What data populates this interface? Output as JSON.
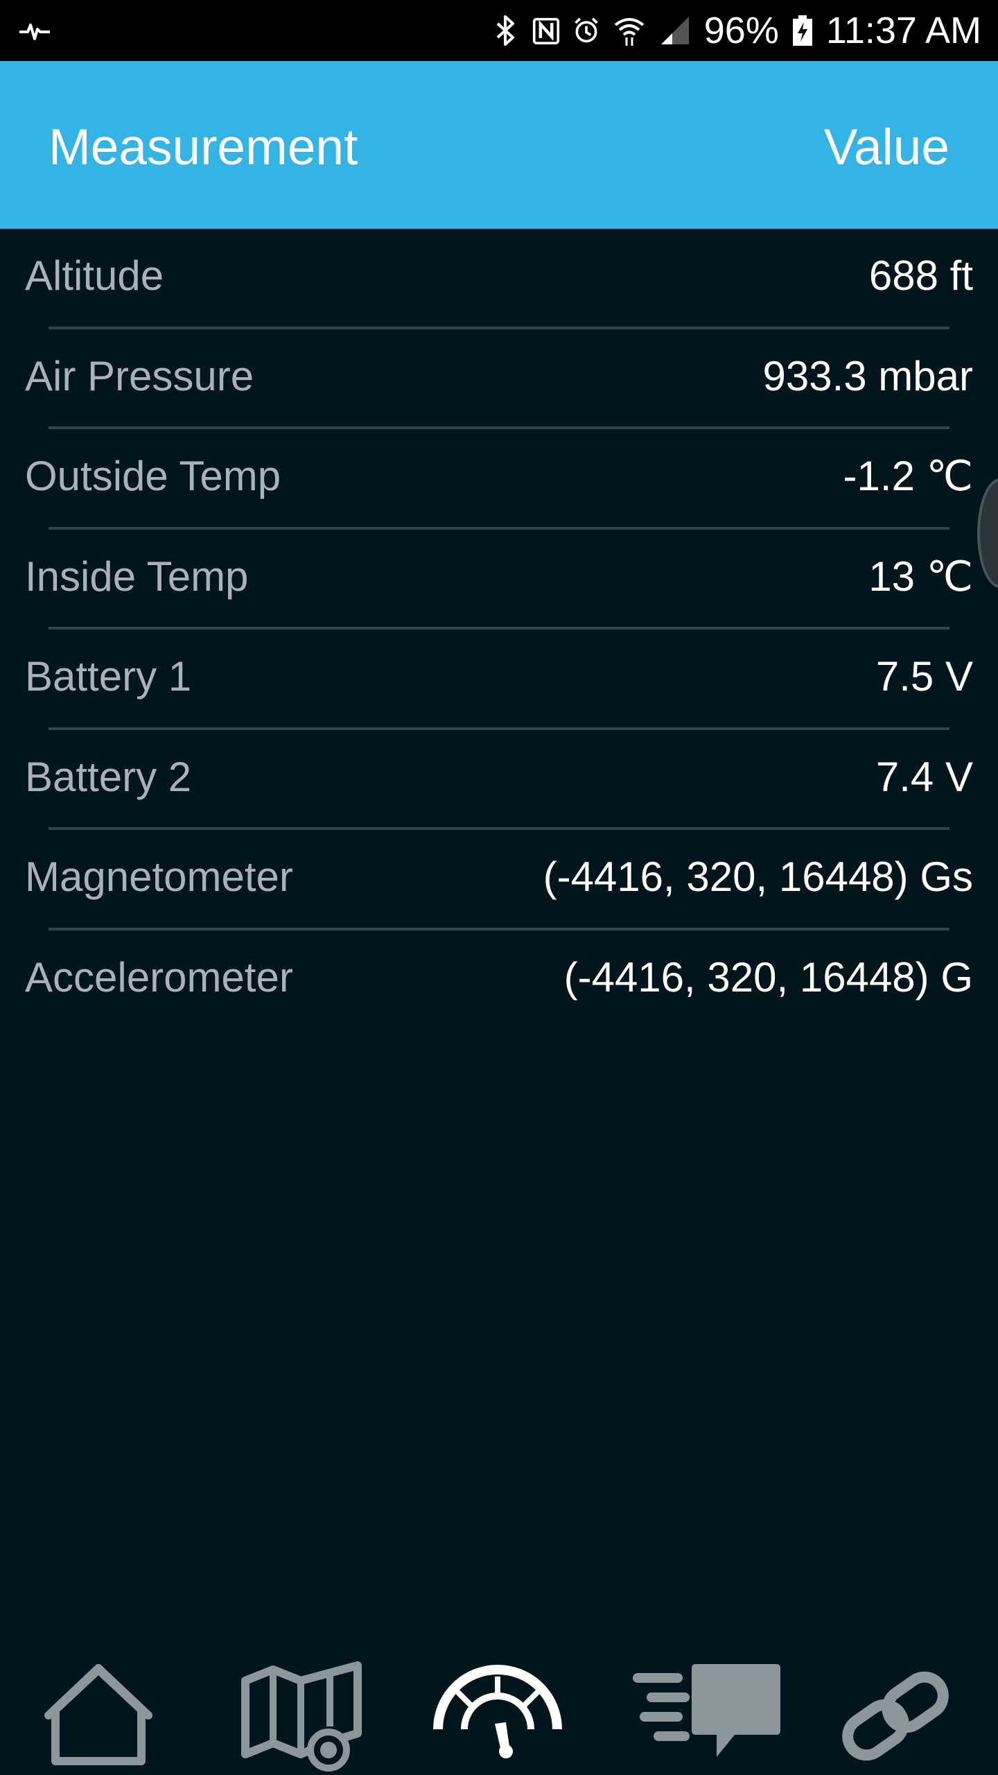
{
  "status_bar": {
    "battery": "96%",
    "time": "11:37 AM",
    "icons": [
      "heartbeat-icon",
      "bluetooth-icon",
      "nfc-icon",
      "alarm-icon",
      "wifi-icon",
      "signal-icon",
      "battery-charging-icon"
    ]
  },
  "header": {
    "col_measurement": "Measurement",
    "col_value": "Value",
    "background_color": "#34b4e4"
  },
  "measurements": [
    {
      "label": "Altitude",
      "value": "688 ft"
    },
    {
      "label": "Air Pressure",
      "value": "933.3 mbar"
    },
    {
      "label": "Outside Temp",
      "value": "-1.2 ℃"
    },
    {
      "label": "Inside Temp",
      "value": "13 ℃"
    },
    {
      "label": "Battery 1",
      "value": "7.5 V"
    },
    {
      "label": "Battery 2",
      "value": "7.4 V"
    },
    {
      "label": "Magnetometer",
      "value": "(-4416, 320, 16448) Gs"
    },
    {
      "label": "Accelerometer",
      "value": "(-4416, 320, 16448) G"
    }
  ],
  "bottom_nav": {
    "items": [
      {
        "icon": "home-icon",
        "active": false
      },
      {
        "icon": "map-icon",
        "active": false
      },
      {
        "icon": "gauge-icon",
        "active": true
      },
      {
        "icon": "messages-icon",
        "active": false
      },
      {
        "icon": "link-icon",
        "active": false
      }
    ],
    "active_color": "#ffffff",
    "inactive_color": "#8c979b"
  }
}
